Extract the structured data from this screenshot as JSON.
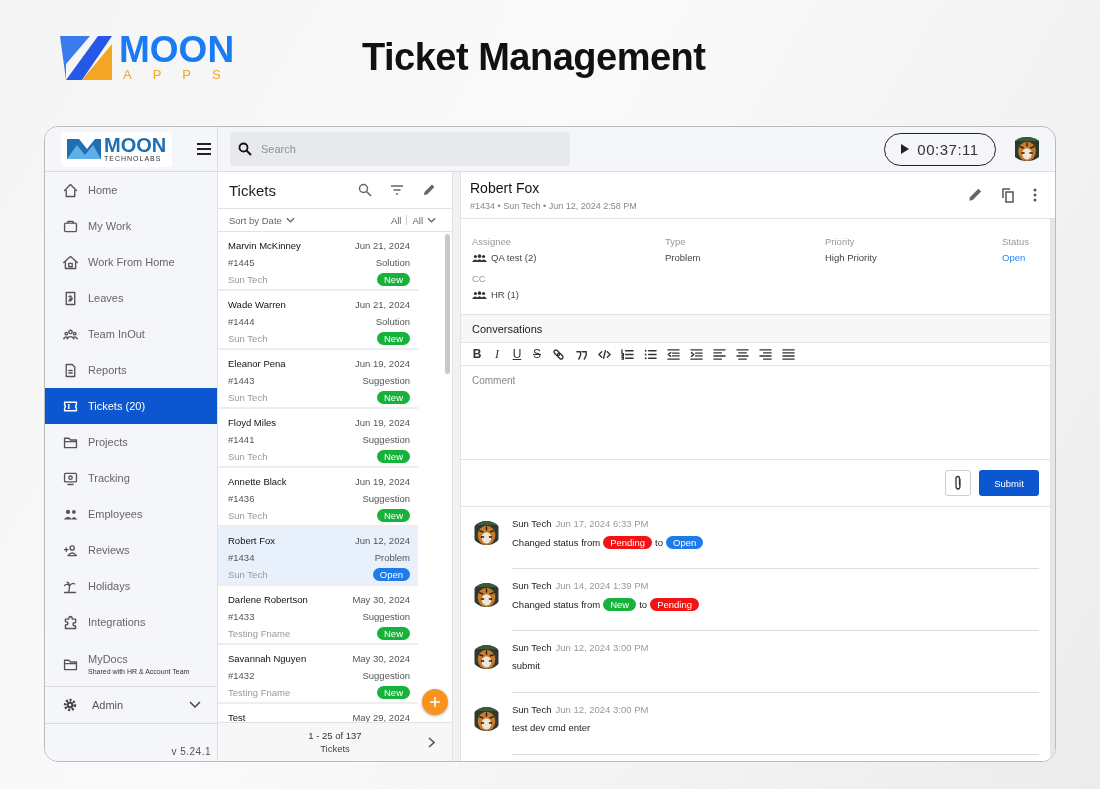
{
  "brand": {
    "name": "MOON",
    "sub": "APPS"
  },
  "page_title": "Ticket Management",
  "app": {
    "logo": {
      "name": "MOON",
      "sub": "TECHNOLABS"
    },
    "search": {
      "placeholder": "Search"
    },
    "timer": "00:37:11",
    "sidebar": {
      "items": [
        {
          "label": "Home",
          "selected": false
        },
        {
          "label": "My Work",
          "selected": false
        },
        {
          "label": "Work From Home",
          "selected": false
        },
        {
          "label": "Leaves",
          "selected": false
        },
        {
          "label": "Team InOut",
          "selected": false
        },
        {
          "label": "Reports",
          "selected": false
        },
        {
          "label": "Tickets (20)",
          "selected": true
        },
        {
          "label": "Projects",
          "selected": false
        },
        {
          "label": "Tracking",
          "selected": false
        },
        {
          "label": "Employees",
          "selected": false
        },
        {
          "label": "Reviews",
          "selected": false
        },
        {
          "label": "Holidays",
          "selected": false
        },
        {
          "label": "Integrations",
          "selected": false
        },
        {
          "label": "MyDocs",
          "note": "Shared with HR & Account Team",
          "selected": false
        }
      ],
      "admin": "Admin",
      "version": "v 5.24.1"
    },
    "tickets": {
      "title": "Tickets",
      "sort": "Sort by Date",
      "filter_1": "All",
      "filter_2": "All",
      "rows": [
        {
          "name": "Marvin McKinney",
          "date": "Jun 21, 2024",
          "id": "#1445",
          "type": "Solution",
          "company": "Sun Tech",
          "status": "New",
          "color": "#16b33a",
          "selected": false
        },
        {
          "name": "Wade Warren",
          "date": "Jun 21, 2024",
          "id": "#1444",
          "type": "Solution",
          "company": "Sun Tech",
          "status": "New",
          "color": "#16b33a",
          "selected": false
        },
        {
          "name": "Eleanor Pena",
          "date": "Jun 19, 2024",
          "id": "#1443",
          "type": "Suggestion",
          "company": "Sun Tech",
          "status": "New",
          "color": "#16b33a",
          "selected": false
        },
        {
          "name": "Floyd Miles",
          "date": "Jun 19, 2024",
          "id": "#1441",
          "type": "Suggestion",
          "company": "Sun Tech",
          "status": "New",
          "color": "#16b33a",
          "selected": false
        },
        {
          "name": "Annette Black",
          "date": "Jun 19, 2024",
          "id": "#1436",
          "type": "Suggestion",
          "company": "Sun Tech",
          "status": "New",
          "color": "#16b33a",
          "selected": false
        },
        {
          "name": "Robert Fox",
          "date": "Jun 12, 2024",
          "id": "#1434",
          "type": "Problem",
          "company": "Sun Tech",
          "status": "Open",
          "color": "#1e7be8",
          "selected": true
        },
        {
          "name": "Darlene Robertson",
          "date": "May 30, 2024",
          "id": "#1433",
          "type": "Suggestion",
          "company": "Testing Fname",
          "status": "New",
          "color": "#16b33a",
          "selected": false
        },
        {
          "name": "Savannah Nguyen",
          "date": "May 30, 2024",
          "id": "#1432",
          "type": "Suggestion",
          "company": "Testing Fname",
          "status": "New",
          "color": "#16b33a",
          "selected": false
        },
        {
          "name": "Test",
          "date": "May 29, 2024",
          "selected": false
        }
      ],
      "pager": "1 - 25 of 137",
      "pager_unit": "Tickets"
    },
    "detail": {
      "name": "Robert Fox",
      "meta": "#1434 • Sun Tech • Jun 12, 2024 2:58 PM",
      "fields": [
        {
          "label": "Assignee",
          "value": "QA test (2)",
          "kind": "group"
        },
        {
          "label": "Type",
          "value": "Problem",
          "kind": "plain"
        },
        {
          "label": "Priority",
          "value": "High Priority",
          "kind": "plain"
        },
        {
          "label": "Status",
          "value": "Open",
          "kind": "link"
        }
      ],
      "cc": {
        "label": "CC",
        "value": "HR (1)"
      },
      "conversations": "Conversations",
      "format_letters": [
        "B",
        "I",
        "U",
        "S"
      ],
      "comment": {
        "placeholder": "Comment"
      },
      "submit": "Submit",
      "activity": [
        {
          "author": "Sun Tech",
          "time": "Jun 17, 2024 6:33 PM",
          "kind": "status_change",
          "text": "Changed status from",
          "from": {
            "label": "Pending",
            "color": "#f21414"
          },
          "joiner": "to",
          "to": {
            "label": "Open",
            "color": "#1e7be8"
          }
        },
        {
          "author": "Sun Tech",
          "time": "Jun 14, 2024 1:39 PM",
          "kind": "status_change",
          "text": "Changed status from",
          "from": {
            "label": "New",
            "color": "#16b33a"
          },
          "joiner": "to",
          "to": {
            "label": "Pending",
            "color": "#f21414"
          }
        },
        {
          "author": "Sun Tech",
          "time": "Jun 12, 2024 3:00 PM",
          "kind": "comment",
          "text": "submit"
        },
        {
          "author": "Sun Tech",
          "time": "Jun 12, 2024 3:00 PM",
          "kind": "comment",
          "text": "test dev cmd enter"
        }
      ]
    }
  }
}
